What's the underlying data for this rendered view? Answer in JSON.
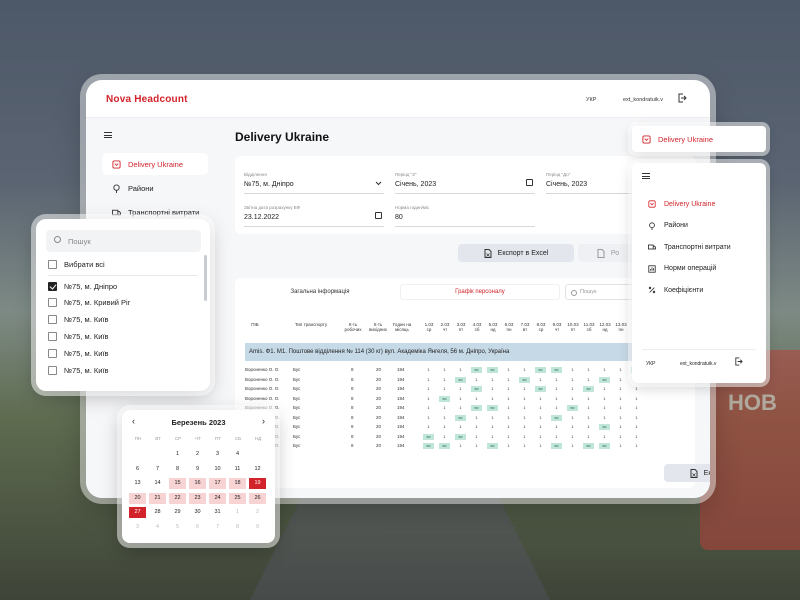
{
  "app": {
    "brand": "Nova Headcount",
    "lang": "УКР",
    "user": "ext_kondratuik.v"
  },
  "sidebar": {
    "items": [
      {
        "label": "Delivery Ukraine",
        "icon": "shield-icon",
        "active": true
      },
      {
        "label": "Райони",
        "icon": "location-icon"
      },
      {
        "label": "Транспортні витрати",
        "icon": "truck-icon"
      }
    ]
  },
  "main": {
    "title": "Delivery Ukraine",
    "form": {
      "branch_label": "Відділення",
      "branch_value": "№75, м. Дніпро",
      "from_label": "Період \"З\"",
      "from_value": "Січень, 2023",
      "to_label": "Період \"До\"",
      "to_value": "Січень, 2023",
      "report_label": "Звітна дата розрахунку БФ",
      "report_value": "23.12.2022",
      "norm_label": "Норма годин/міс",
      "norm_value": "80"
    },
    "export_label": "Експорт в Excel",
    "export2_label": "Ро",
    "tabs": [
      {
        "label": "Загальна інформація"
      },
      {
        "label": "Графік персоналу",
        "active": true
      }
    ],
    "search_placeholder": "Пошук",
    "columns": {
      "pib": "ПІБ",
      "transport": "Тип транспорту",
      "workdays": "К-ть робочих",
      "daysoff": "К-ть вихідних",
      "hours": "Годин на місяць"
    },
    "days": [
      {
        "d": "1.03",
        "w": "ср"
      },
      {
        "d": "2.03",
        "w": "чт"
      },
      {
        "d": "3.03",
        "w": "пт"
      },
      {
        "d": "4.03",
        "w": "сб"
      },
      {
        "d": "5.03",
        "w": "нд"
      },
      {
        "d": "6.03",
        "w": "пн"
      },
      {
        "d": "7.03",
        "w": "вт"
      },
      {
        "d": "8.03",
        "w": "ср"
      },
      {
        "d": "9.03",
        "w": "чт"
      },
      {
        "d": "10.03",
        "w": "пт"
      },
      {
        "d": "11.03",
        "w": "сб"
      },
      {
        "d": "12.03",
        "w": "нд"
      },
      {
        "d": "13.03",
        "w": "пн"
      },
      {
        "d": "14.03",
        "w": "вт"
      }
    ],
    "group_label": "Amis. Ф1. М1. Поштове відділення № 114 (30 кг) вул. Академіка Янгеля, 56 м. Дніпро, Україна",
    "group_bold": "Amis. Ф1. М1. Поштове відділення № 114",
    "rows": [
      {
        "name": "Вороненко О. О.",
        "type": "Бус",
        "work": "8",
        "off": "20",
        "hours": "194",
        "cells": [
          "1",
          "1",
          "1",
          "вх",
          "вх",
          "1",
          "1",
          "вх",
          "вх",
          "1",
          "1",
          "1",
          "1",
          "вх"
        ]
      },
      {
        "name": "Вороненко О. О.",
        "type": "Бус",
        "work": "8",
        "off": "20",
        "hours": "194",
        "cells": [
          "1",
          "1",
          "вх",
          "1",
          "1",
          "1",
          "вх",
          "1",
          "1",
          "1",
          "1",
          "вх",
          "1",
          "1"
        ]
      },
      {
        "name": "Вороненко О. О.",
        "type": "Бус",
        "work": "8",
        "off": "20",
        "hours": "194",
        "cells": [
          "1",
          "1",
          "1",
          "вх",
          "1",
          "1",
          "1",
          "вх",
          "1",
          "1",
          "вх",
          "1",
          "1",
          "1"
        ]
      },
      {
        "name": "Вороненко О. О.",
        "type": "Бус",
        "work": "8",
        "off": "20",
        "hours": "194",
        "cells": [
          "1",
          "вх",
          "1",
          "1",
          "1",
          "1",
          "1",
          "1",
          "1",
          "1",
          "1",
          "1",
          "1",
          "1"
        ]
      },
      {
        "name": "Вороненко О. О.",
        "type": "Бус",
        "work": "8",
        "off": "20",
        "hours": "194",
        "cells": [
          "1",
          "1",
          "1",
          "вх",
          "вх",
          "1",
          "1",
          "1",
          "1",
          "вх",
          "1",
          "1",
          "1",
          "1"
        ]
      },
      {
        "name": "Вороненко О. О.",
        "type": "Бус",
        "work": "8",
        "off": "20",
        "hours": "194",
        "cells": [
          "1",
          "1",
          "вх",
          "1",
          "1",
          "1",
          "1",
          "1",
          "вх",
          "1",
          "1",
          "1",
          "1",
          "1"
        ]
      },
      {
        "name": "Вороненко О. О.",
        "type": "Бус",
        "work": "8",
        "off": "20",
        "hours": "194",
        "cells": [
          "1",
          "1",
          "1",
          "1",
          "1",
          "1",
          "1",
          "1",
          "1",
          "1",
          "1",
          "вх",
          "1",
          "1"
        ]
      },
      {
        "name": "Вороненко О. О.",
        "type": "Бус",
        "work": "8",
        "off": "20",
        "hours": "194",
        "cells": [
          "вх",
          "1",
          "вх",
          "1",
          "1",
          "1",
          "1",
          "1",
          "1",
          "1",
          "1",
          "1",
          "1",
          "1"
        ]
      },
      {
        "name": "Вороненко О. О.",
        "type": "Бус",
        "work": "8",
        "off": "20",
        "hours": "194",
        "cells": [
          "вх",
          "вх",
          "1",
          "1",
          "вх",
          "1",
          "1",
          "1",
          "вх",
          "1",
          "вх",
          "вх",
          "1",
          "1"
        ]
      }
    ]
  },
  "dropdown": {
    "search_placeholder": "Пошук",
    "select_all": "Вибрати всі",
    "items": [
      {
        "label": "№75, м. Дніпро",
        "checked": true
      },
      {
        "label": "№75, м. Кривий Ріг"
      },
      {
        "label": "№75, м. Київ"
      },
      {
        "label": "№75, м. Київ"
      },
      {
        "label": "№75, м. Київ"
      },
      {
        "label": "№75, м. Київ"
      }
    ]
  },
  "calendar": {
    "title": "Березень 2023",
    "dow": [
      "ПН",
      "ВТ",
      "СР",
      "ЧТ",
      "ПТ",
      "СБ",
      "НД"
    ],
    "weeks": [
      [
        "",
        "",
        "1",
        "2",
        "3",
        "4",
        "5"
      ],
      [
        "6",
        "7",
        "8",
        "9",
        "10",
        "11",
        "12"
      ],
      [
        "13",
        "14",
        "15",
        "16",
        "17",
        "18",
        "19"
      ],
      [
        "20",
        "21",
        "22",
        "23",
        "24",
        "25",
        "26"
      ],
      [
        "27",
        "28",
        "29",
        "30",
        "31",
        "1",
        "2"
      ],
      [
        "3",
        "4",
        "5",
        "6",
        "7",
        "8",
        "9"
      ]
    ],
    "shown_weeks": [
      [
        "",
        "",
        "1",
        "2",
        "3",
        "4"
      ],
      [
        "6",
        "7",
        "8",
        "9",
        "10",
        "11",
        "12"
      ]
    ]
  },
  "calendar_grid": [
    [
      "",
      "",
      "",
      "1",
      "2",
      "3",
      "4"
    ],
    [
      "5",
      "6",
      "7",
      "8",
      "9",
      "10",
      "11"
    ],
    [
      "12",
      "13",
      "14",
      "15",
      "16",
      "17",
      "18"
    ],
    [
      "19",
      "20",
      "21",
      "22",
      "23",
      "24",
      "25"
    ],
    [
      "26",
      "27",
      "28",
      "29",
      "30",
      "1",
      "2"
    ],
    [
      "3",
      "4",
      "",
      "",
      "",
      "",
      ""
    ]
  ],
  "calendar_rows_visible": [
    [
      "",
      "1",
      "2",
      "3",
      "4"
    ],
    [
      "6",
      "7",
      "8",
      "9",
      "10",
      "11",
      "12"
    ]
  ],
  "cal": {
    "title": "Березень 2023",
    "rows": [
      [
        "",
        "",
        "1",
        "2",
        "3",
        "4"
      ],
      [
        "6",
        "7",
        "8",
        "9",
        "10",
        "11",
        "12"
      ]
    ]
  },
  "calendar_view": {
    "title": "Березень 2023",
    "dow": [
      "ПН",
      "ВТ",
      "СР",
      "ЧТ",
      "ПТ",
      "СБ",
      "НД"
    ],
    "weeks": [
      [
        "",
        "",
        "1",
        "2",
        "3",
        "4",
        ""
      ],
      [
        "6",
        "7",
        "8",
        "9",
        "10",
        "11",
        "12"
      ],
      [
        "13",
        "14",
        "15",
        "16",
        "17",
        "18",
        "19"
      ],
      [
        "20",
        "21",
        "22",
        "23",
        "24",
        "25",
        "26"
      ],
      [
        "27",
        "28",
        "29",
        "30",
        "31",
        "1",
        "2"
      ],
      [
        "3",
        "4",
        "5",
        "6",
        "7",
        "8",
        "9"
      ]
    ]
  },
  "calendar_visible": {
    "title": "Березень 2023",
    "dow": [
      "ПН",
      "ВТ",
      "СР",
      "ЧТ",
      "ПТ",
      "СБ",
      "НД"
    ],
    "weeks": [
      [
        "",
        "",
        "1",
        "2",
        "3",
        "4"
      ],
      [
        "6",
        "7",
        "8",
        "9",
        "10",
        "11",
        "12"
      ]
    ]
  },
  "calendar_final": {
    "title": "Березень 2023",
    "dow": [
      "ПН",
      "ВТ",
      "СР",
      "ЧТ",
      "ПТ",
      "СБ",
      "НД"
    ],
    "weeks": [
      [
        "",
        "",
        "1",
        "2",
        "3",
        "4",
        ""
      ],
      [
        "6",
        "7",
        "8",
        "9",
        "10",
        "11",
        "12"
      ]
    ]
  },
  "cal_widget": {
    "title": "Березень 2023",
    "dow": [
      "ПН",
      "ВТ",
      "СР",
      "ЧТ",
      "ПТ",
      "СБ",
      "НД"
    ],
    "weeks": [
      [
        "",
        "",
        "1",
        "2",
        "3",
        "4",
        ""
      ],
      [
        "6",
        "7",
        "8",
        "9",
        "10",
        "11",
        "12"
      ],
      [
        "13",
        "14",
        "15",
        "16",
        "17",
        "18",
        "19"
      ],
      [
        "20",
        "21",
        "22",
        "23",
        "24",
        "25",
        "26"
      ],
      [
        "27",
        "28",
        "29",
        "30",
        "31",
        "1",
        "2"
      ],
      [
        "3",
        "4",
        "5",
        "6",
        "7",
        "8",
        "9"
      ]
    ],
    "range": [
      "20",
      "21",
      "22",
      "23",
      "24",
      "25",
      "26",
      "15",
      "16",
      "17",
      "18",
      "19"
    ],
    "selected": [
      "19",
      "27"
    ]
  },
  "right_panel": {
    "pill_label": "Delivery Ukraine",
    "items": [
      {
        "label": "Delivery Ukraine",
        "icon": "shield-icon",
        "active": true
      },
      {
        "label": "Райони",
        "icon": "location-icon"
      },
      {
        "label": "Транспортні витрати",
        "icon": "truck-icon"
      },
      {
        "label": "Норми операцій",
        "icon": "chart-icon"
      },
      {
        "label": "Коефіцієнти",
        "icon": "percent-icon"
      }
    ],
    "lang": "УКР",
    "user": "ext_kondratuik.v"
  },
  "colors": {
    "accent": "#d2232a",
    "weekend_cell": "#bfe6d9",
    "group_row": "#c6d9e6"
  }
}
